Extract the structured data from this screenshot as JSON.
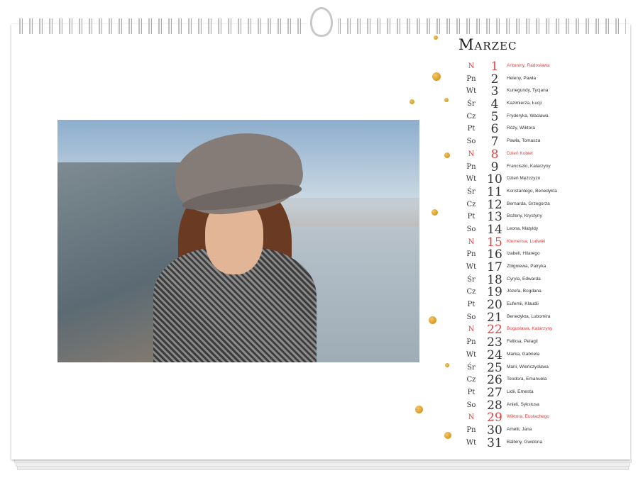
{
  "calendar": {
    "month": "Marzec",
    "days": [
      {
        "dow": "N",
        "day": "1",
        "names": "Antoniny, Radosława",
        "sunday": true
      },
      {
        "dow": "Pn",
        "day": "2",
        "names": "Heleny, Pawła",
        "sunday": false
      },
      {
        "dow": "Wt",
        "day": "3",
        "names": "Kunegundy, Tycjana",
        "sunday": false
      },
      {
        "dow": "Śr",
        "day": "4",
        "names": "Kazimierza, Łucji",
        "sunday": false
      },
      {
        "dow": "Cz",
        "day": "5",
        "names": "Fryderyka, Wacława",
        "sunday": false
      },
      {
        "dow": "Pt",
        "day": "6",
        "names": "Róży, Wiktora",
        "sunday": false
      },
      {
        "dow": "So",
        "day": "7",
        "names": "Pawła, Tomasza",
        "sunday": false
      },
      {
        "dow": "N",
        "day": "8",
        "names": "Dzień Kobiet",
        "sunday": true
      },
      {
        "dow": "Pn",
        "day": "9",
        "names": "Franciszki, Katarzyny",
        "sunday": false
      },
      {
        "dow": "Wt",
        "day": "10",
        "names": "Dzień Mężczyzn",
        "sunday": false
      },
      {
        "dow": "Śr",
        "day": "11",
        "names": "Konstantego, Benedykta",
        "sunday": false
      },
      {
        "dow": "Cz",
        "day": "12",
        "names": "Bernarda, Grzegorza",
        "sunday": false
      },
      {
        "dow": "Pt",
        "day": "13",
        "names": "Bożeny, Krystyny",
        "sunday": false
      },
      {
        "dow": "So",
        "day": "14",
        "names": "Leona, Matyldy",
        "sunday": false
      },
      {
        "dow": "N",
        "day": "15",
        "names": "Klemensa, Ludwiki",
        "sunday": true
      },
      {
        "dow": "Pn",
        "day": "16",
        "names": "Izabeli, Hilarego",
        "sunday": false
      },
      {
        "dow": "Wt",
        "day": "17",
        "names": "Zbigniewa, Patryka",
        "sunday": false
      },
      {
        "dow": "Śr",
        "day": "18",
        "names": "Cyryla, Edwarda",
        "sunday": false
      },
      {
        "dow": "Cz",
        "day": "19",
        "names": "Józefa, Bogdana",
        "sunday": false
      },
      {
        "dow": "Pt",
        "day": "20",
        "names": "Eufemii, Klaudii",
        "sunday": false
      },
      {
        "dow": "So",
        "day": "21",
        "names": "Benedykta, Lubomira",
        "sunday": false
      },
      {
        "dow": "N",
        "day": "22",
        "names": "Bogusława, Katarzyny",
        "sunday": true
      },
      {
        "dow": "Pn",
        "day": "23",
        "names": "Feliksa, Pelagii",
        "sunday": false
      },
      {
        "dow": "Wt",
        "day": "24",
        "names": "Marka, Gabriela",
        "sunday": false
      },
      {
        "dow": "Śr",
        "day": "25",
        "names": "Marii, Wieńczysława",
        "sunday": false
      },
      {
        "dow": "Cz",
        "day": "26",
        "names": "Teodora, Emanuela",
        "sunday": false
      },
      {
        "dow": "Pt",
        "day": "27",
        "names": "Lidii, Ernesta",
        "sunday": false
      },
      {
        "dow": "So",
        "day": "28",
        "names": "Anieli, Sykstusa",
        "sunday": false
      },
      {
        "dow": "N",
        "day": "29",
        "names": "Wiktora, Eustachego",
        "sunday": true
      },
      {
        "dow": "Pn",
        "day": "30",
        "names": "Amelii, Jana",
        "sunday": false
      },
      {
        "dow": "Wt",
        "day": "31",
        "names": "Balbiny, Gwidona",
        "sunday": false
      }
    ]
  },
  "colors": {
    "holiday": "#e5403f",
    "text": "#333333",
    "gold_dot": "#d99a21"
  }
}
